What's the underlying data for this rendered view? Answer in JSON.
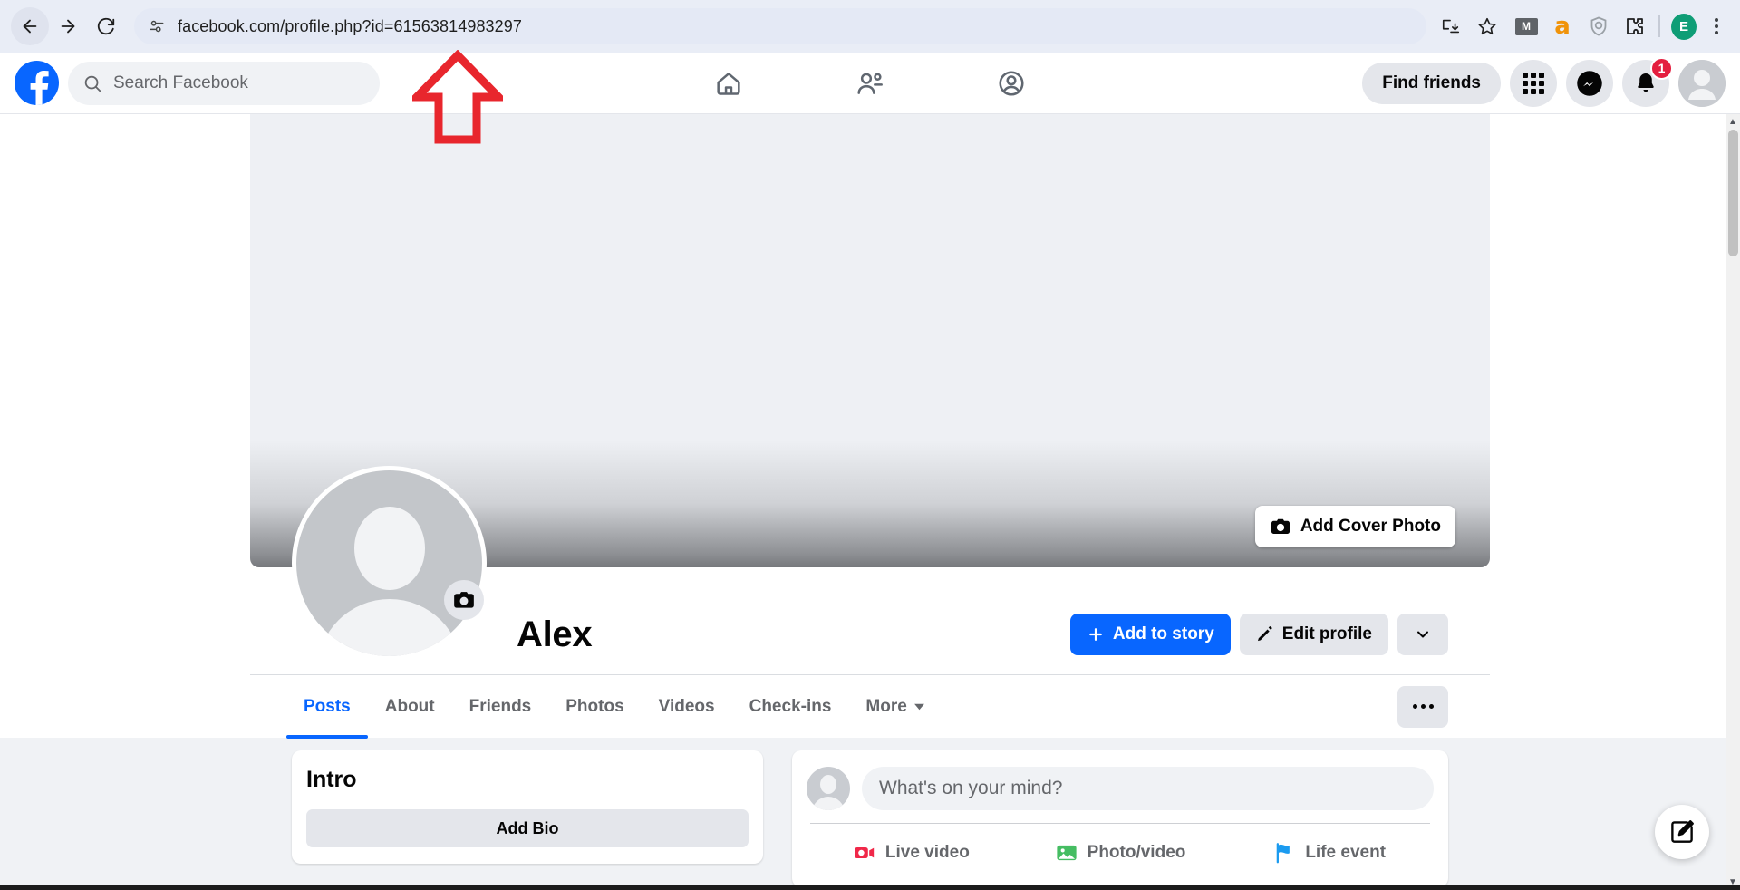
{
  "browser": {
    "url": "facebook.com/profile.php?id=61563814983297",
    "back_icon": "back-arrow-icon",
    "forward_icon": "forward-arrow-icon",
    "reload_icon": "reload-icon",
    "site_settings_icon": "site-settings-icon",
    "install_icon": "install-app-icon",
    "bookmark_icon": "star-icon",
    "extensions": [
      {
        "name": "gmail-extension-icon",
        "label": "M"
      },
      {
        "name": "amazon-extension-icon",
        "label": "a"
      },
      {
        "name": "shield-extension-icon",
        "label": ""
      },
      {
        "name": "extensions-puzzle-icon",
        "label": ""
      }
    ],
    "profile_avatar_letter": "E",
    "menu_icon": "chrome-menu-icon"
  },
  "fb_header": {
    "logo": "facebook-logo",
    "search_placeholder": "Search Facebook",
    "search_icon": "search-icon",
    "nav": [
      {
        "name": "home",
        "icon": "home-icon"
      },
      {
        "name": "friends",
        "icon": "friends-icon"
      },
      {
        "name": "profile",
        "icon": "profile-circle-icon"
      }
    ],
    "find_friends_label": "Find friends",
    "menu_grid_icon": "apps-grid-icon",
    "messenger_icon": "messenger-icon",
    "notifications_icon": "bell-icon",
    "notifications_count": "1",
    "account_avatar": "account-avatar"
  },
  "cover": {
    "add_cover_label": "Add Cover Photo",
    "camera_icon": "camera-icon"
  },
  "profile": {
    "name": "Alex",
    "profile_photo_camera_icon": "camera-icon",
    "add_to_story_label": "Add to story",
    "add_to_story_icon": "plus-icon",
    "edit_profile_label": "Edit profile",
    "edit_profile_icon": "pencil-icon",
    "more_dropdown_icon": "chevron-down-icon"
  },
  "tabs": {
    "items": [
      {
        "label": "Posts",
        "active": true
      },
      {
        "label": "About",
        "active": false
      },
      {
        "label": "Friends",
        "active": false
      },
      {
        "label": "Photos",
        "active": false
      },
      {
        "label": "Videos",
        "active": false
      },
      {
        "label": "Check-ins",
        "active": false
      },
      {
        "label": "More",
        "active": false,
        "dropdown": true
      }
    ],
    "more_options_icon": "ellipsis-icon"
  },
  "intro": {
    "title": "Intro",
    "add_bio_label": "Add Bio"
  },
  "composer": {
    "placeholder": "What's on your mind?",
    "actions": [
      {
        "label": "Live video",
        "icon": "live-video-icon",
        "color": "#f02849"
      },
      {
        "label": "Photo/video",
        "icon": "photo-video-icon",
        "color": "#45bd62"
      },
      {
        "label": "Life event",
        "icon": "life-event-flag-icon",
        "color": "#1b9bf0"
      }
    ]
  },
  "overlays": {
    "compose_fab_icon": "compose-pencil-icon",
    "annotation_arrow": "red-up-arrow-annotation",
    "annotation_color": "#e8262d"
  },
  "colors": {
    "facebook_blue": "#0866ff",
    "badge_red": "#e41e3f",
    "page_bg": "#f0f2f5"
  }
}
